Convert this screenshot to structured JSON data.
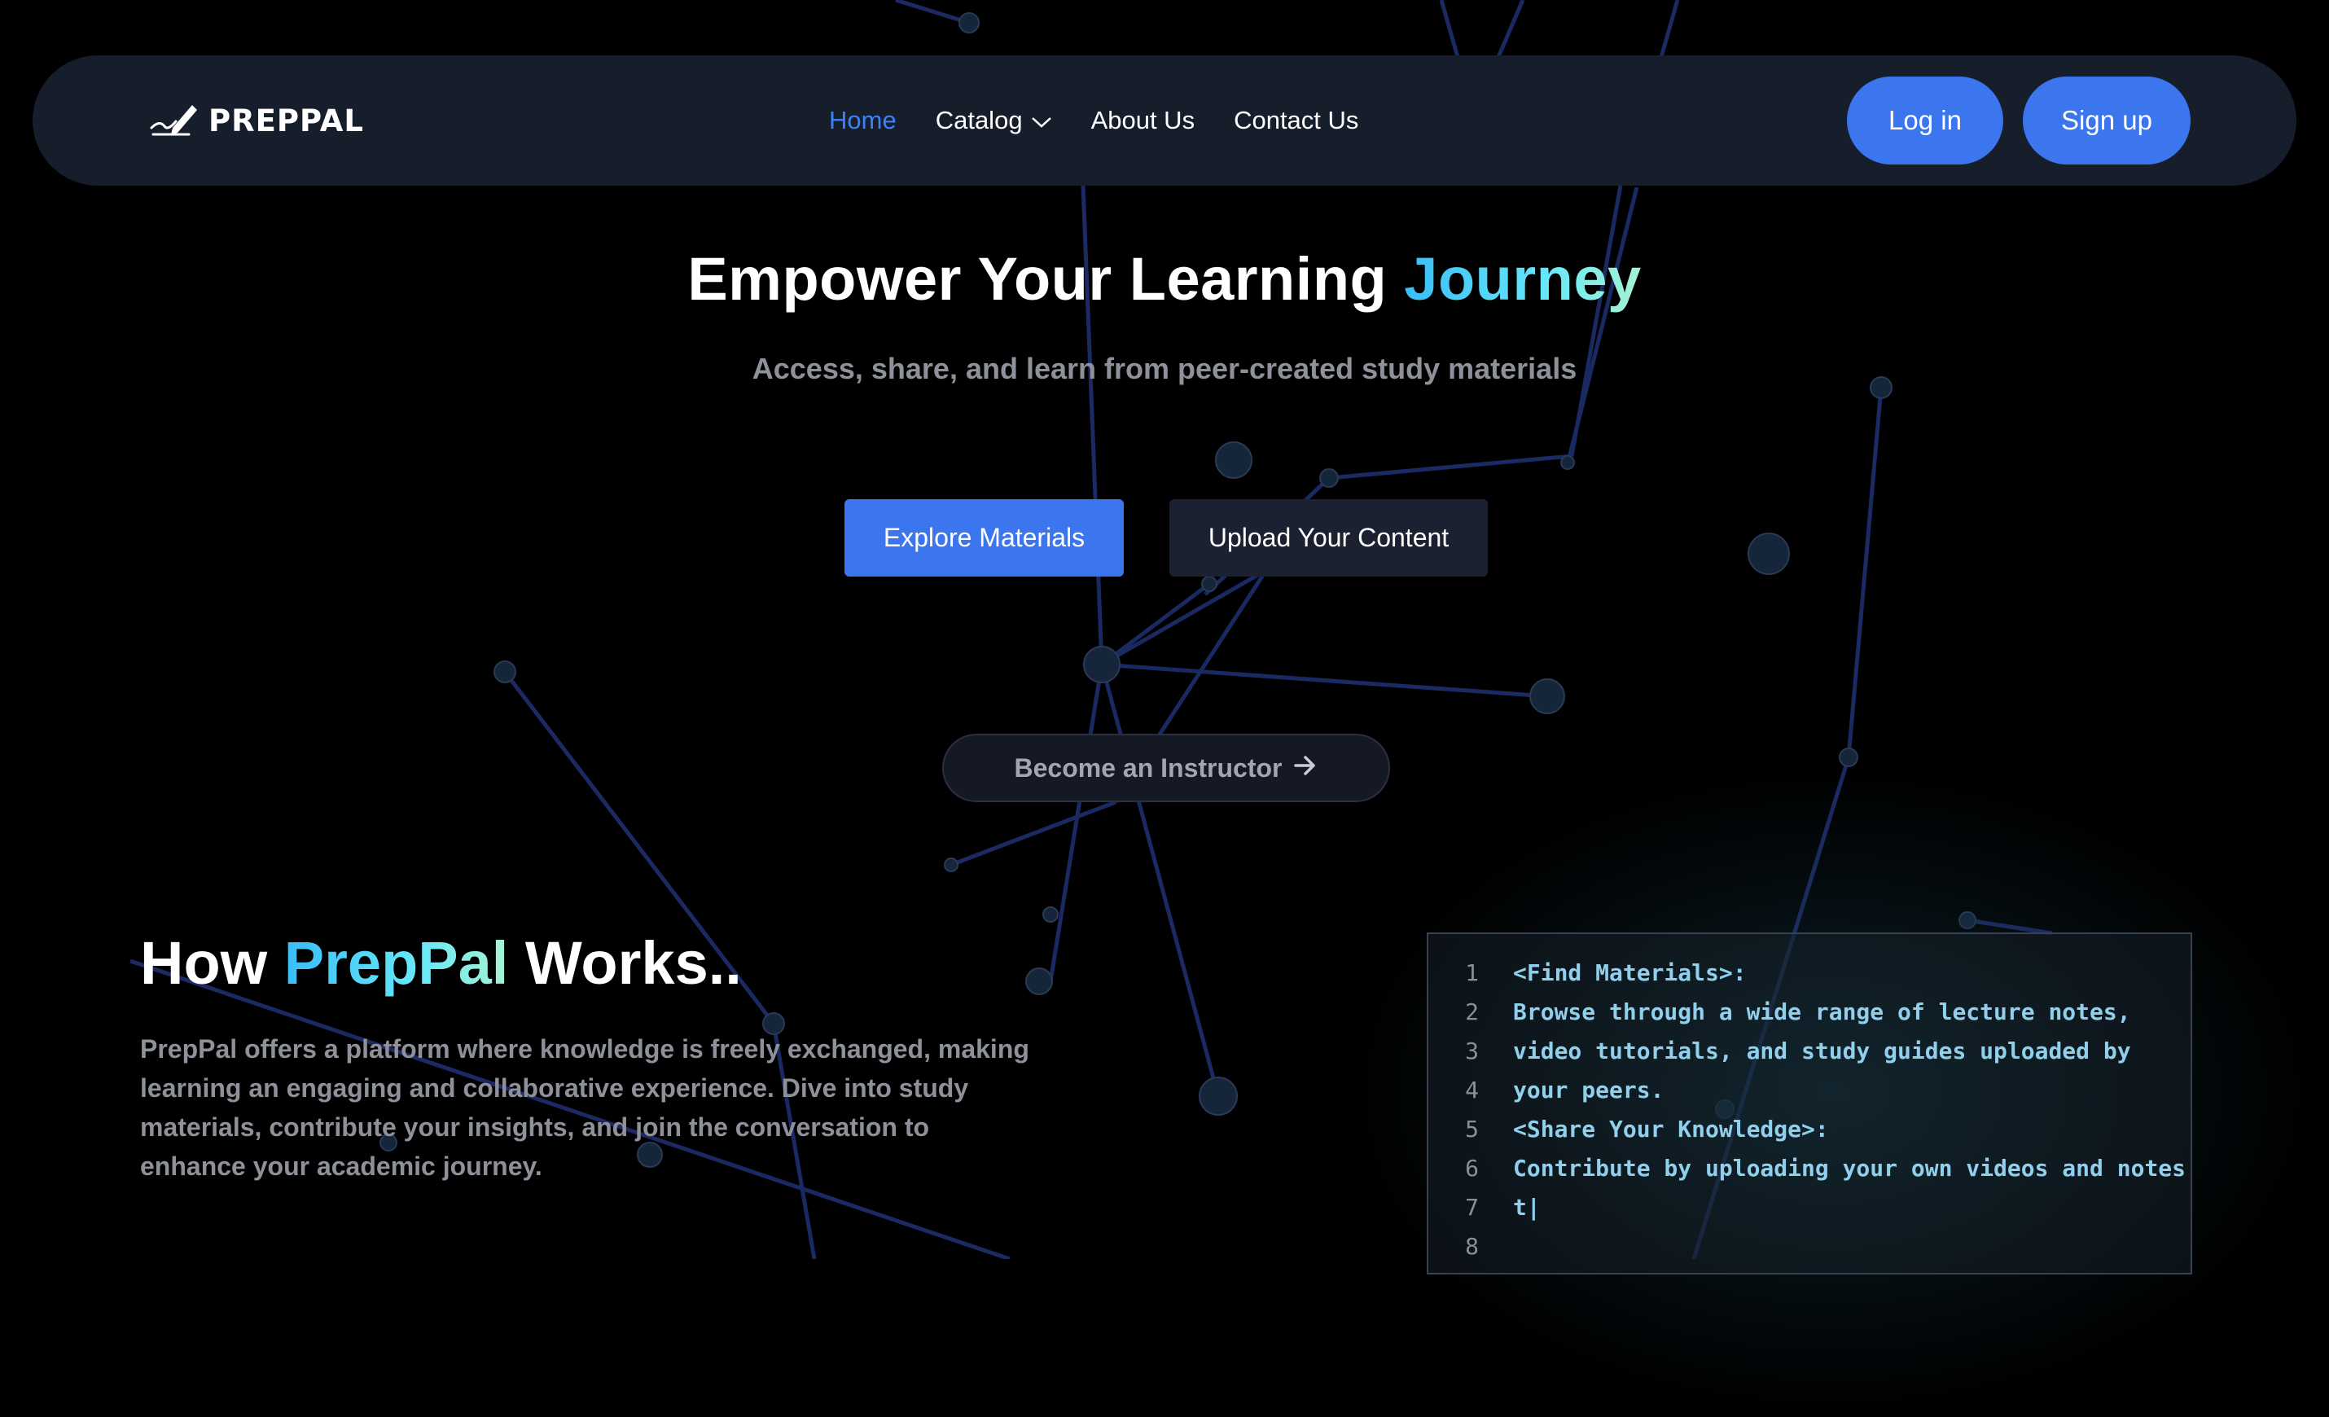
{
  "brand": {
    "logo_text": "PREPPAL"
  },
  "nav": {
    "links": [
      {
        "label": "Home",
        "active": true
      },
      {
        "label": "Catalog",
        "has_dropdown": true
      },
      {
        "label": "About Us"
      },
      {
        "label": "Contact Us"
      }
    ],
    "login_label": "Log in",
    "signup_label": "Sign up"
  },
  "hero": {
    "title_prefix": "Empower Your Learning ",
    "title_highlight": "Journey",
    "subtitle": "Access, share, and learn from peer-created study materials",
    "explore_label": "Explore Materials",
    "upload_label": "Upload Your Content",
    "instructor_label": "Become an Instructor"
  },
  "how": {
    "title_prefix": "How ",
    "title_highlight": "PrepPal",
    "title_suffix": " Works..",
    "description": "PrepPal offers a platform where knowledge is freely exchanged, making learning an engaging and collaborative experience. Dive into study materials, contribute your insights, and join the conversation to enhance your academic journey."
  },
  "code_panel": {
    "lines": [
      {
        "num": "1",
        "text": "<Find Materials>:"
      },
      {
        "num": "2",
        "text": "Browse through a wide range of lecture notes,"
      },
      {
        "num": "3",
        "text": "video tutorials, and study guides uploaded by"
      },
      {
        "num": "4",
        "text": "your peers."
      },
      {
        "num": "5",
        "text": "<Share Your Knowledge>:"
      },
      {
        "num": "6",
        "text": "Contribute by uploading your own videos and notes"
      },
      {
        "num": "7",
        "text": "t|"
      },
      {
        "num": "8",
        "text": ""
      }
    ]
  },
  "colors": {
    "accent": "#3b76ef",
    "active_link": "#3b82f6",
    "background": "#000000",
    "navbar": "#161d2b",
    "code_text": "#8fd0ec"
  },
  "icons": {
    "logo": "pen-signature-icon",
    "dropdown": "chevron-down-icon",
    "instructor": "arrow-right-icon"
  }
}
